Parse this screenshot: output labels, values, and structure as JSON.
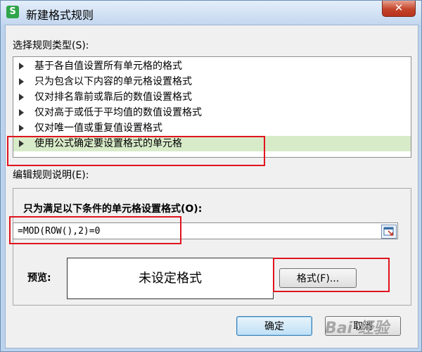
{
  "window": {
    "app_icon": "S",
    "title": "新建格式规则",
    "close_label": "✕"
  },
  "rule_type": {
    "label": "选择规则类型(S):",
    "items": [
      "基于各自值设置所有单元格的格式",
      "只为包含以下内容的单元格设置格式",
      "仅对排名靠前或靠后的数值设置格式",
      "仅对高于或低于平均值的数值设置格式",
      "仅对唯一值或重复值设置格式",
      "使用公式确定要设置格式的单元格"
    ],
    "selected_index": 5
  },
  "description": {
    "label": "编辑规则说明(E):",
    "formula_label": "只为满足以下条件的单元格设置格式(O):",
    "formula_value": "=MOD(ROW(),2)=0",
    "ref_button_icon": "collapse-dialog-icon",
    "preview_label": "预览:",
    "preview_text": "未设定格式",
    "format_button": "格式(F)..."
  },
  "footer": {
    "ok_label": "确定",
    "cancel_label": "取消"
  },
  "watermark": "Bai 经验",
  "highlight_color": "#e0141e",
  "selected_row_color": "#d8ebc9"
}
